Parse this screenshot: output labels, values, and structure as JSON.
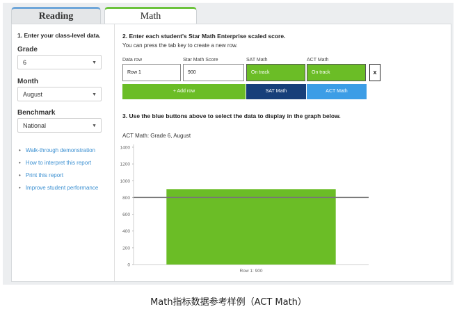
{
  "tabs": [
    {
      "label": "Reading",
      "active": false
    },
    {
      "label": "Math",
      "active": true
    }
  ],
  "left": {
    "heading": "1. Enter your class-level data.",
    "grade": {
      "label": "Grade",
      "value": "6"
    },
    "month": {
      "label": "Month",
      "value": "August"
    },
    "benchmark": {
      "label": "Benchmark",
      "value": "National"
    },
    "links": [
      "Walk-through demonstration",
      "How to interpret this report",
      "Print this report",
      "Improve student performance"
    ]
  },
  "right": {
    "heading2": "2. Enter each student's Star Math Enterprise scaled score.",
    "subtext": "You can press the tab key to create a new row.",
    "columns": [
      "Data row",
      "Star Math Score",
      "SAT Math",
      "ACT Math"
    ],
    "row": {
      "data_row": "Row 1",
      "score": "900",
      "sat": "On track",
      "act": "On track"
    },
    "remove_label": "x",
    "add_row_label": "+ Add row",
    "sat_button": "SAT Math",
    "act_button": "ACT Math",
    "heading3": "3. Use the blue buttons above to select the data to display in the graph below."
  },
  "colors": {
    "green": "#6bbd26",
    "navy": "#173f7a",
    "blue": "#3c9de6",
    "benchmark_line": "#777777"
  },
  "chart_data": {
    "type": "bar",
    "title": "ACT Math: Grade 6, August",
    "categories": [
      "Row 1: 900"
    ],
    "values": [
      900
    ],
    "benchmark": 800,
    "ylim": [
      0,
      1400
    ],
    "yticks": [
      "0",
      "200",
      "400",
      "600",
      "800",
      "1000",
      "1200",
      "1400"
    ],
    "grid": false
  },
  "caption": "Math指标数据参考样例（ACT Math）"
}
